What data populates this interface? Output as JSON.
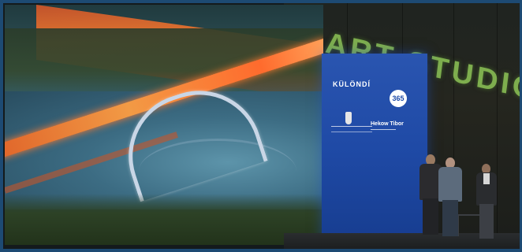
{
  "scene": {
    "description_tags": [
      "led-screen",
      "bridge",
      "sponsor-panel",
      "stage",
      "people"
    ]
  },
  "wall_text": "ELL ART STUDIOS",
  "sponsor_panel": {
    "logo_text": "KÜLÖNDÍ",
    "logo_365": "365",
    "speaker_name": "Hekow Tibor"
  },
  "colors": {
    "frame": "#1d4a73",
    "studio_text": "#7eae4e",
    "sponsor_blue": "#1f4aa6",
    "road_orange": "#f29a45"
  }
}
